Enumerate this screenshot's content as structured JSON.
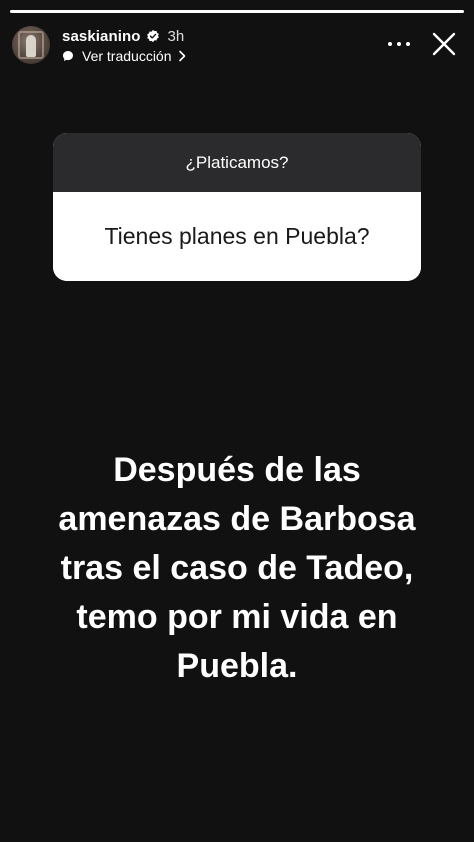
{
  "story": {
    "progress": {
      "segments": 1,
      "current": 1,
      "fill_fraction": 1.0
    },
    "header": {
      "username": "saskianino",
      "time_ago": "3h",
      "translate_label": "Ver traducción",
      "verified": true
    },
    "question_sticker": {
      "title": "¿Platicamos?",
      "answer": "Tienes planes en Puebla?"
    },
    "text_lines": [
      "Después de las",
      "amenazas de Barbosa",
      "tras el caso de Tadeo,",
      "temo por mi vida en",
      "Puebla."
    ],
    "icons": {
      "verified": "verified-badge-icon",
      "translate": "speech-bubble-icon",
      "more": "more-options-icon",
      "close": "close-icon",
      "chevron": "chevron-right-icon"
    },
    "colors": {
      "background": "#111111",
      "sticker_header": "#2b2b2d",
      "sticker_body": "#ffffff",
      "text": "#ffffff"
    }
  }
}
